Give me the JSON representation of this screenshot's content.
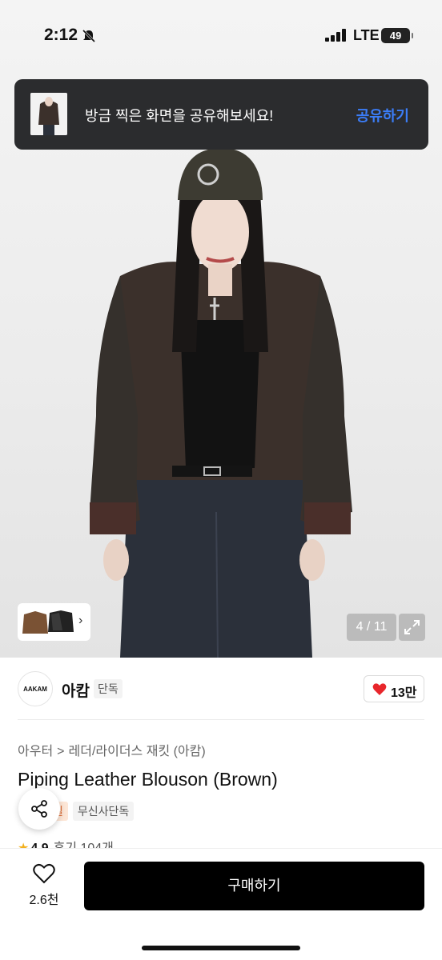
{
  "status_bar": {
    "time": "2:12",
    "network": "LTE",
    "battery": "49"
  },
  "share_toast": {
    "message": "방금 찍은 화면을 공유해보세요!",
    "action": "공유하기"
  },
  "gallery": {
    "counter": "4 / 11",
    "thumb_chevron": "›"
  },
  "brand": {
    "logo_text": "AAKAM",
    "name": "아캄",
    "tag": "단독",
    "like_count": "13만"
  },
  "breadcrumb": {
    "items": [
      "아우터",
      "레더/라이더스 재킷 (아캄)"
    ],
    "separator": ">"
  },
  "product": {
    "title": "Piping Leather Blouson (Brown)",
    "badges": [
      "일",
      "무신사단독"
    ],
    "rating": "4.9",
    "reviews": "후기 104개"
  },
  "bottom_bar": {
    "wish_count": "2.6천",
    "buy_label": "구매하기"
  },
  "colors": {
    "toast_bg": "#2b2c2e",
    "toast_action": "#3b7df8",
    "heart": "#e8262b",
    "buy_bg": "#000000"
  }
}
